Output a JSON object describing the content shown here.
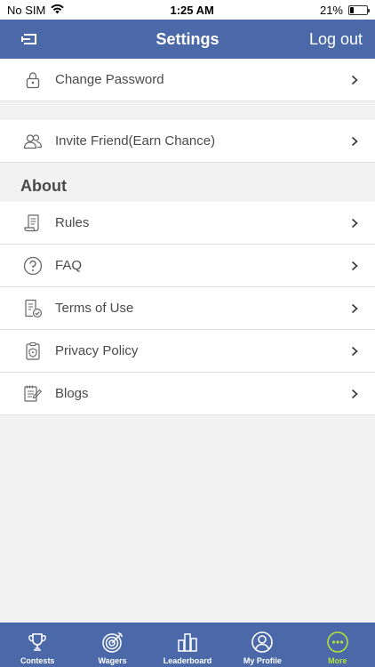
{
  "status_bar": {
    "carrier": "No SIM",
    "time": "1:25 AM",
    "battery": "21%",
    "battery_level": 0.21
  },
  "nav": {
    "title": "Settings",
    "right_label": "Log out",
    "left_icon": "exit-icon"
  },
  "rows_top": [
    {
      "label": "Change Password",
      "icon": "lock-icon"
    }
  ],
  "rows_mid": [
    {
      "label": "Invite Friend(Earn Chance)",
      "icon": "users-icon"
    }
  ],
  "about": {
    "header": "About",
    "items": [
      {
        "label": "Rules",
        "icon": "scroll-icon"
      },
      {
        "label": "FAQ",
        "icon": "question-circle-icon"
      },
      {
        "label": "Terms of Use",
        "icon": "document-check-icon"
      },
      {
        "label": "Privacy Policy",
        "icon": "shield-clipboard-icon"
      },
      {
        "label": "Blogs",
        "icon": "notes-pen-icon"
      }
    ]
  },
  "tabs": [
    {
      "label": "Contests",
      "icon": "trophy-icon",
      "active": false
    },
    {
      "label": "Wagers",
      "icon": "target-icon",
      "active": false
    },
    {
      "label": "Leaderboard",
      "icon": "bar-chart-icon",
      "active": false
    },
    {
      "label": "My Profile",
      "icon": "user-circle-icon",
      "active": false
    },
    {
      "label": "More",
      "icon": "more-dots-icon",
      "active": true
    }
  ],
  "colors": {
    "primary": "#4b69a8",
    "active_tab": "#b6df3c",
    "background": "#f2f2f2",
    "text": "#4a4a4a"
  }
}
